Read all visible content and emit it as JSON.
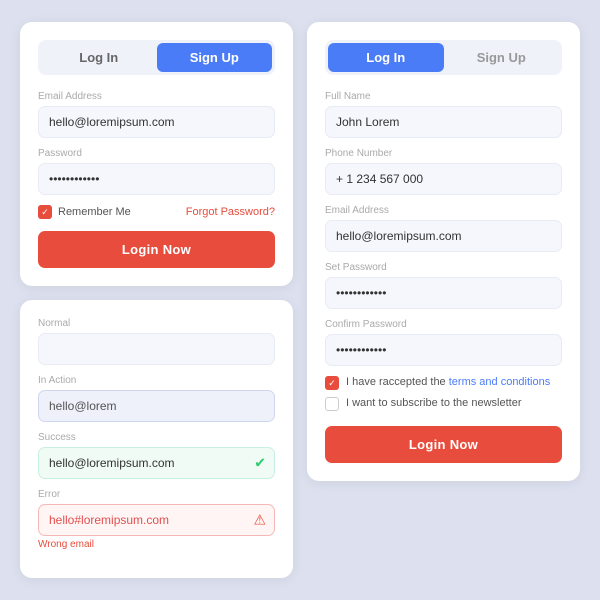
{
  "leftTop": {
    "tabs": [
      {
        "label": "Log In",
        "state": "inactive"
      },
      {
        "label": "Sign Up",
        "state": "active"
      }
    ],
    "fields": [
      {
        "label": "Email Address",
        "value": "hello@loremipsum.com",
        "type": "text"
      },
      {
        "label": "Password",
        "value": "••••••••••••",
        "type": "password"
      }
    ],
    "remember": "Remember Me",
    "forgot": "Forgot Password?",
    "loginBtn": "Login Now"
  },
  "leftBottom": {
    "fields": [
      {
        "label": "Normal",
        "value": "",
        "state": "normal"
      },
      {
        "label": "In Action",
        "value": "hello@lorem",
        "state": "in-action"
      },
      {
        "label": "Success",
        "value": "hello@loremipsum.com",
        "state": "success"
      },
      {
        "label": "Error",
        "value": "hello#loremipsum.com",
        "state": "error"
      }
    ],
    "errorMsg": "Wrong email"
  },
  "right": {
    "tabs": [
      {
        "label": "Log In",
        "state": "active"
      },
      {
        "label": "Sign Up",
        "state": "inactive"
      }
    ],
    "fields": [
      {
        "label": "Full Name",
        "value": "John Lorem"
      },
      {
        "label": "Phone Number",
        "value": "+ 1 234 567 000"
      },
      {
        "label": "Email Address",
        "value": "hello@loremipsum.com"
      },
      {
        "label": "Set Password",
        "value": "••••••••••••"
      },
      {
        "label": "Confirm Password",
        "value": "••••••••••••"
      }
    ],
    "terms": [
      {
        "text": "I have raccepted the ",
        "link": "terms and conditions",
        "checked": true
      },
      {
        "text": "I want to subscribe to the newsletter",
        "link": "",
        "checked": false
      }
    ],
    "loginBtn": "Login Now"
  }
}
